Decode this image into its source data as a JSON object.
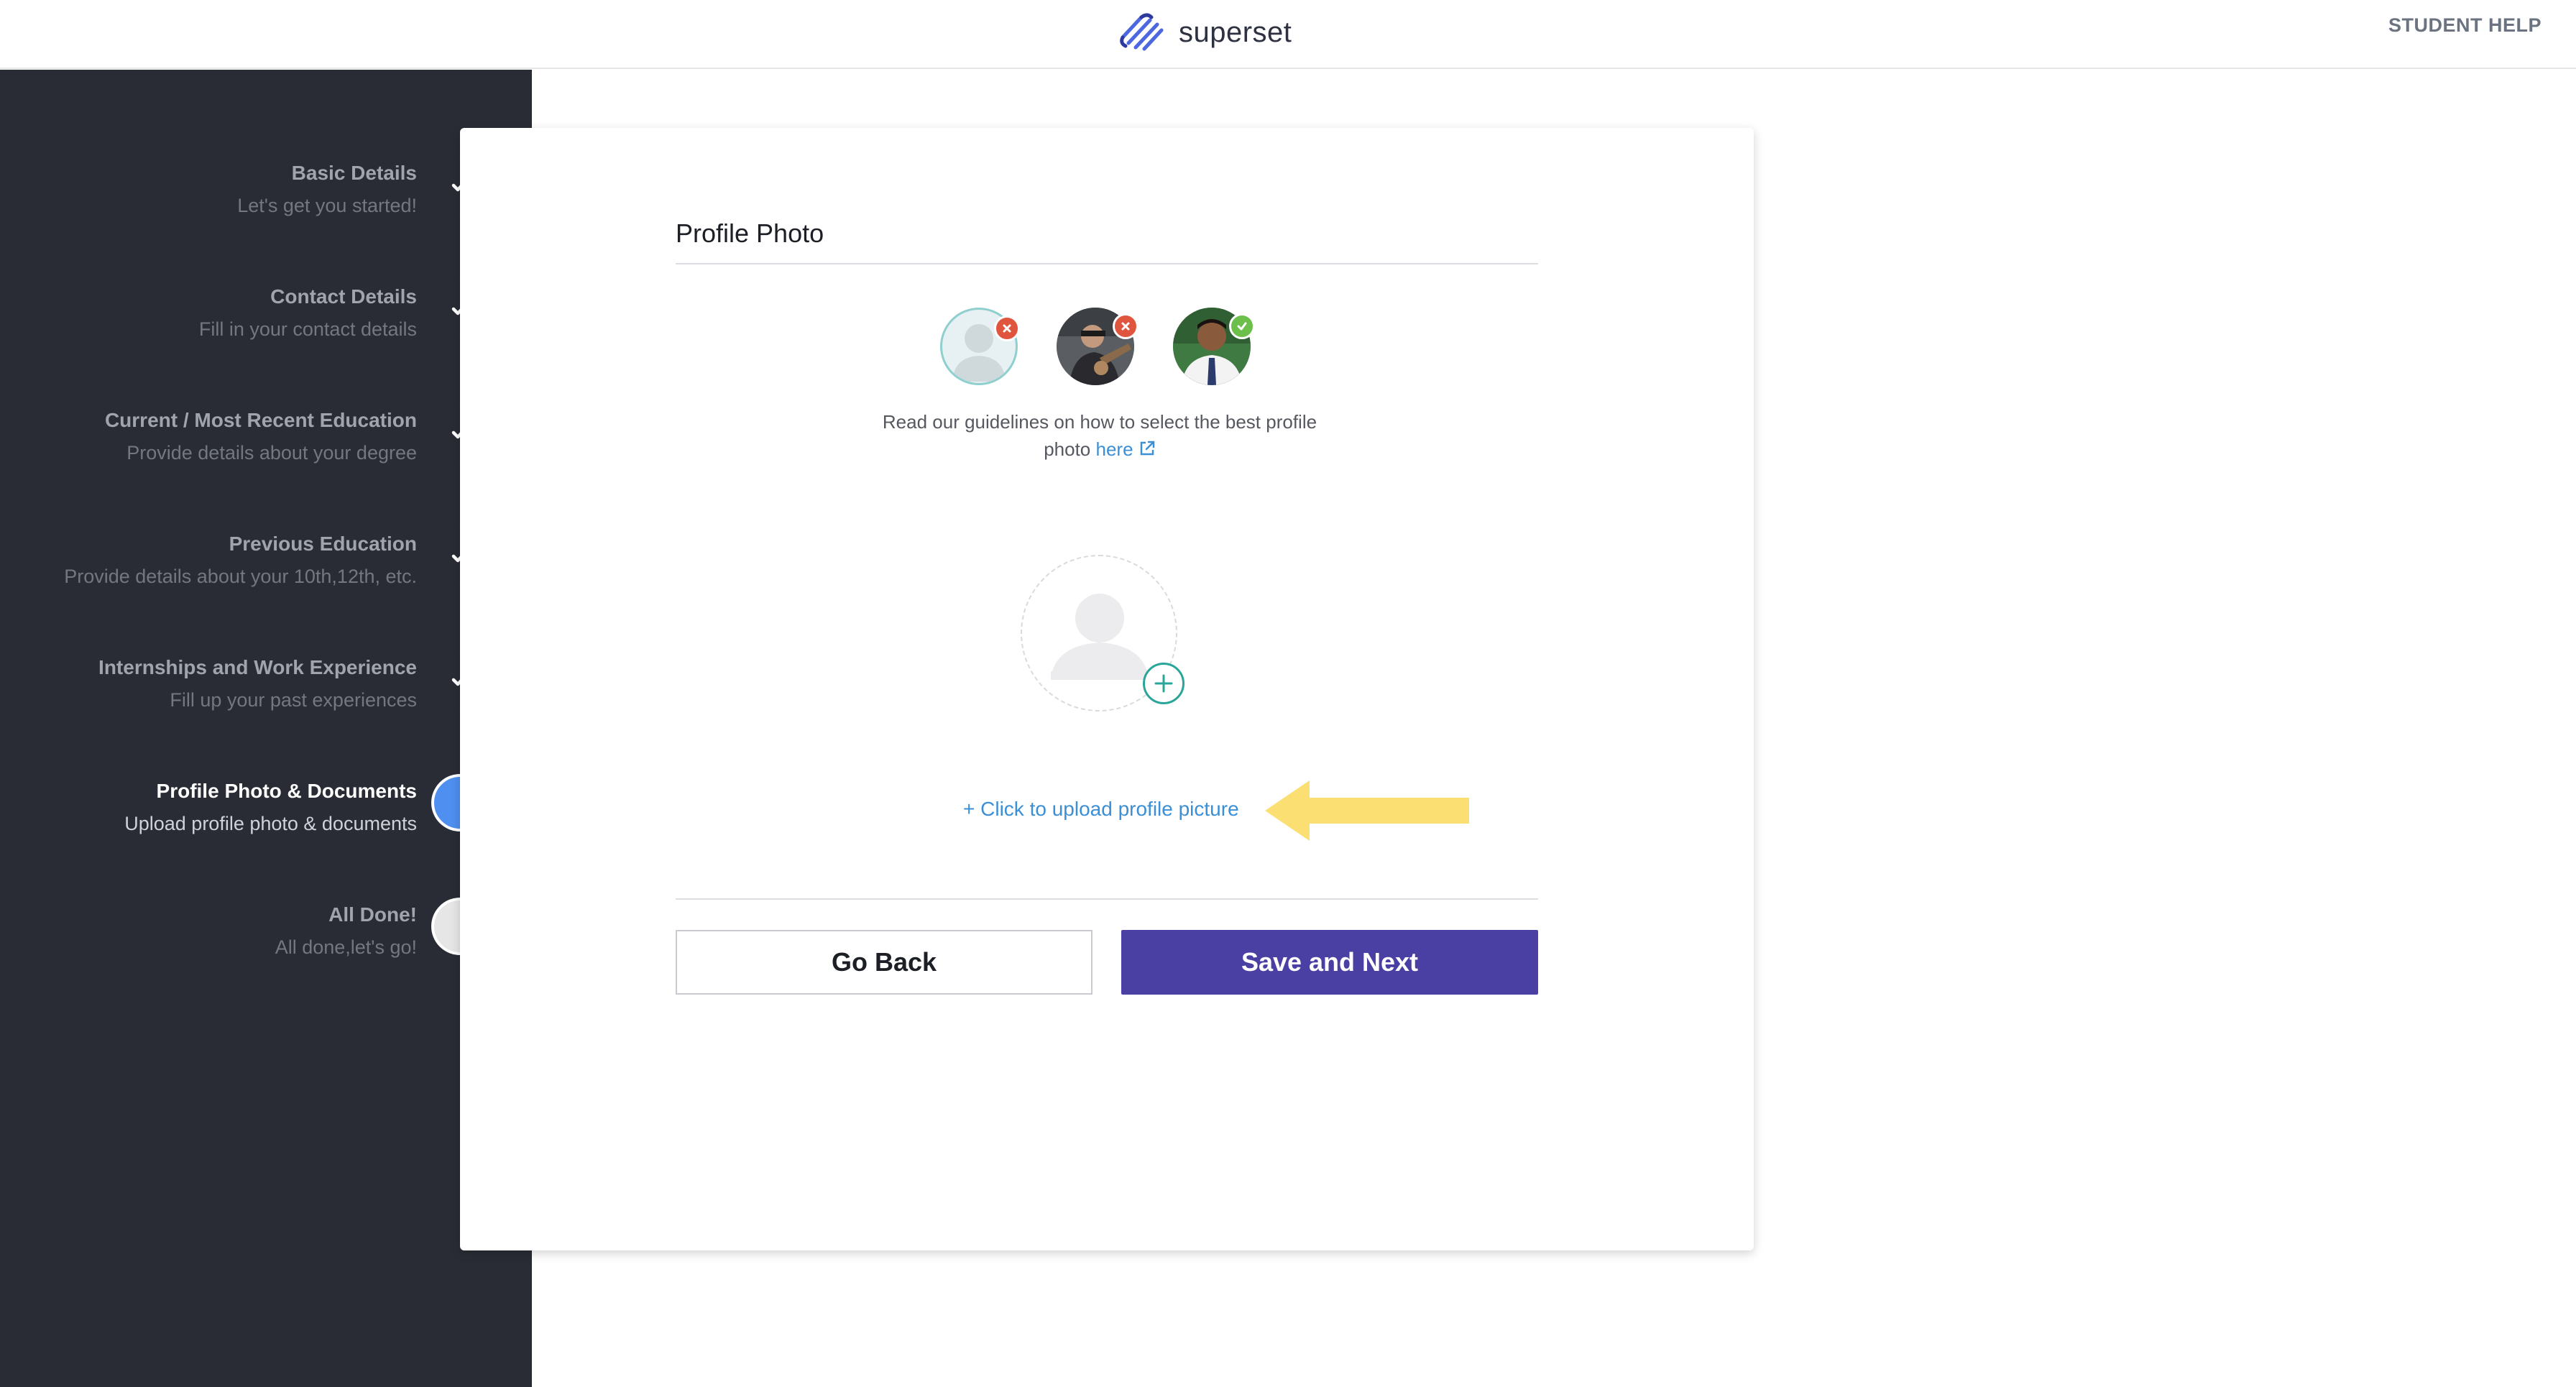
{
  "header": {
    "logo_text": "superset",
    "help_link": "STUDENT HELP",
    "brand_color": "#4a3fa3"
  },
  "sidebar": {
    "steps": [
      {
        "title": "Basic Details",
        "subtitle": "Let's get you started!",
        "status": "done"
      },
      {
        "title": "Contact Details",
        "subtitle": "Fill in your contact details",
        "status": "done"
      },
      {
        "title": "Current / Most Recent Education",
        "subtitle": "Provide details about your degree",
        "status": "done"
      },
      {
        "title": "Previous Education",
        "subtitle": "Provide details about your 10th,12th, etc.",
        "status": "done"
      },
      {
        "title": "Internships and Work Experience",
        "subtitle": "Fill up your past experiences",
        "status": "done"
      },
      {
        "title": "Profile Photo & Documents",
        "subtitle": "Upload profile photo & documents",
        "status": "active"
      },
      {
        "title": "All Done!",
        "subtitle": "All done,let's go!",
        "status": "pending"
      }
    ]
  },
  "main": {
    "section_title": "Profile Photo",
    "examples": [
      {
        "kind": "default-avatar",
        "verdict": "reject"
      },
      {
        "kind": "group-photo",
        "verdict": "reject"
      },
      {
        "kind": "formal-portrait",
        "verdict": "accept"
      }
    ],
    "guidelines_text": "Read our guidelines on how to select the best profile photo",
    "guidelines_link": "here",
    "upload_link": "+ Click to upload profile picture",
    "back_button": "Go Back",
    "next_button": "Save and Next"
  },
  "colors": {
    "sidebar_bg": "#2a2c35",
    "active_step": "#4e8ff0",
    "link": "#3b8fd6",
    "reject_badge": "#e0553e",
    "accept_badge": "#6dbf4b",
    "arrow": "#fbdf73"
  }
}
